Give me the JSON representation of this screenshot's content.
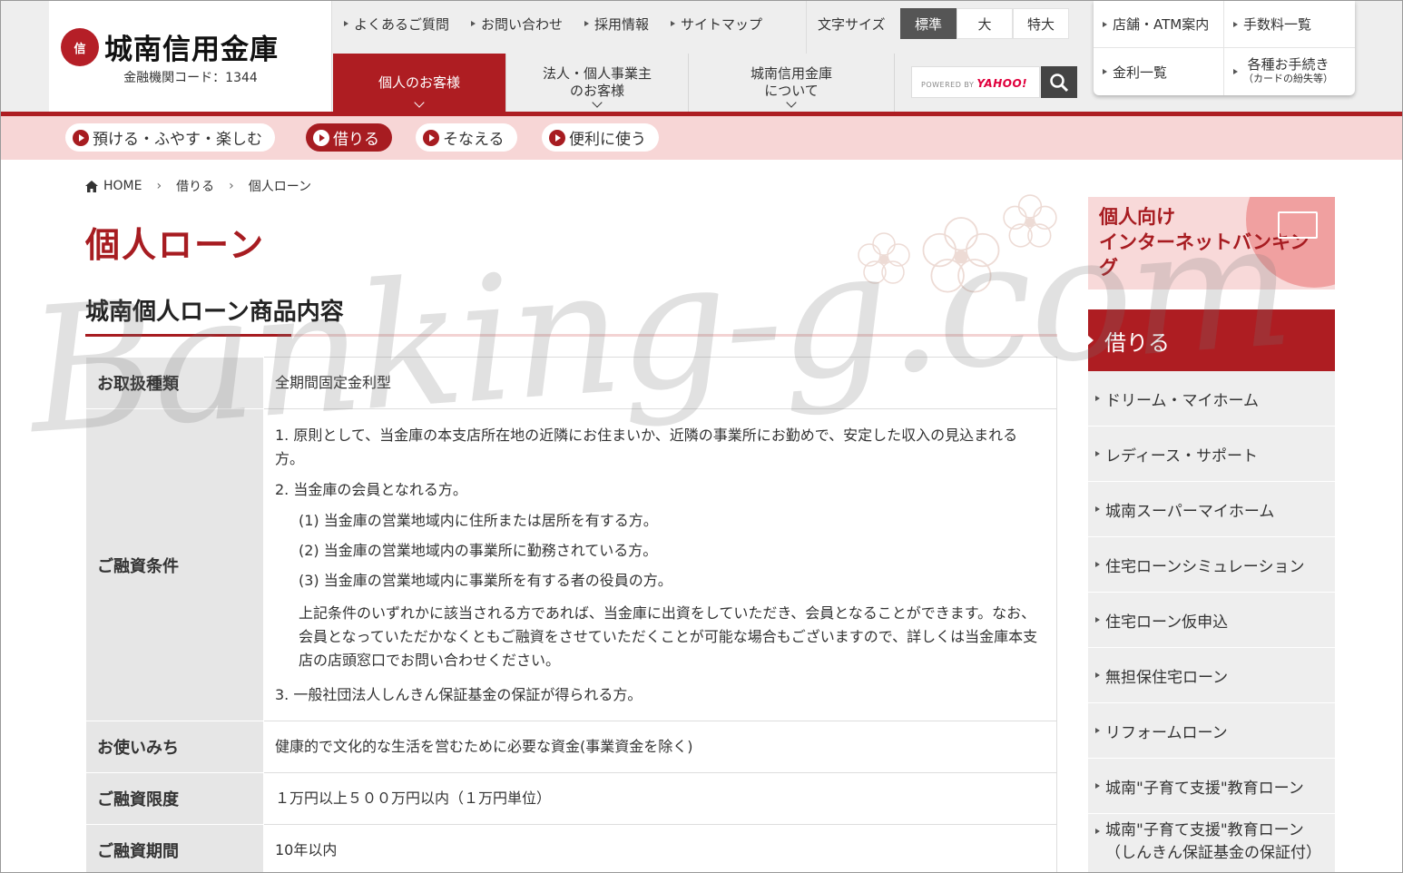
{
  "header": {
    "logo_mark": "信",
    "logo_text": "城南信用金庫",
    "bank_code": "金融機関コード：1344",
    "top_links": [
      "よくあるご質問",
      "お問い合わせ",
      "採用情報",
      "サイトマップ"
    ],
    "font_size": {
      "label": "文字サイズ",
      "options": [
        "標準",
        "大",
        "特大"
      ],
      "selected": "標準"
    },
    "main_nav": [
      {
        "label": "個人のお客様",
        "active": true
      },
      {
        "label": "法人・個人事業主\nのお客様",
        "active": false
      },
      {
        "label": "城南信用金庫\nについて",
        "active": false
      }
    ],
    "search": {
      "powered_by": "POWERED BY",
      "brand": "YAHOO!"
    },
    "quick_links": [
      "店舗・ATM案内",
      "手数料一覧",
      "金利一覧",
      "各種お手続き",
      "（カードの紛失等）"
    ]
  },
  "subnav": [
    {
      "label": "預ける・ふやす・楽しむ",
      "active": false
    },
    {
      "label": "借りる",
      "active": true
    },
    {
      "label": "そなえる",
      "active": false
    },
    {
      "label": "便利に使う",
      "active": false
    }
  ],
  "breadcrumb": [
    "HOME",
    "借りる",
    "個人ローン"
  ],
  "page_title": "個人ローン",
  "section_title": "城南個人ローン商品内容",
  "table": {
    "rows": [
      {
        "label": "お取扱種類",
        "value": "全期間固定金利型"
      },
      {
        "label": "ご融資条件"
      },
      {
        "label": "お使いみち",
        "value": "健康的で文化的な生活を営むために必要な資金(事業資金を除く)"
      },
      {
        "label": "ご融資限度",
        "value": "１万円以上５００万円以内（１万円単位）"
      },
      {
        "label": "ご融資期間",
        "value": "10年以内"
      }
    ],
    "conditions": {
      "c1": "1. 原則として、当金庫の本支店所在地の近隣にお住まいか、近隣の事業所にお勤めで、安定した収入の見込まれる方。",
      "c2": "2. 当金庫の会員となれる方。",
      "s1": "(1) 当金庫の営業地域内に住所または居所を有する方。",
      "s2": "(2) 当金庫の営業地域内の事業所に勤務されている方。",
      "s3": "(3) 当金庫の営業地域内に事業所を有する者の役員の方。",
      "note": "上記条件のいずれかに該当される方であれば、当金庫に出資をしていただき、会員となることができます。なお、会員となっていただかなくともご融資をさせていただくことが可能な場合もございますので、詳しくは当金庫本支店の店頭窓口でお問い合わせください。",
      "c3": "3. 一般社団法人しんきん保証基金の保証が得られる方。"
    }
  },
  "sidebar": {
    "ib_banner": "個人向け\nインターネットバンキング",
    "heading": "借りる",
    "items": [
      "ドリーム・マイホーム",
      "レディース・サポート",
      "城南スーパーマイホーム",
      "住宅ローンシミュレーション",
      "住宅ローン仮申込",
      "無担保住宅ローン",
      "リフォームローン",
      "城南\"子育て支援\"教育ローン",
      "城南\"子育て支援\"教育ローン（しんきん保証基金の保証付）"
    ]
  },
  "watermark": "Banking-g.com",
  "colors": {
    "brand_red": "#ae1d22",
    "pink_bg": "#f7d6d6",
    "header_gray": "#eeeeee"
  }
}
